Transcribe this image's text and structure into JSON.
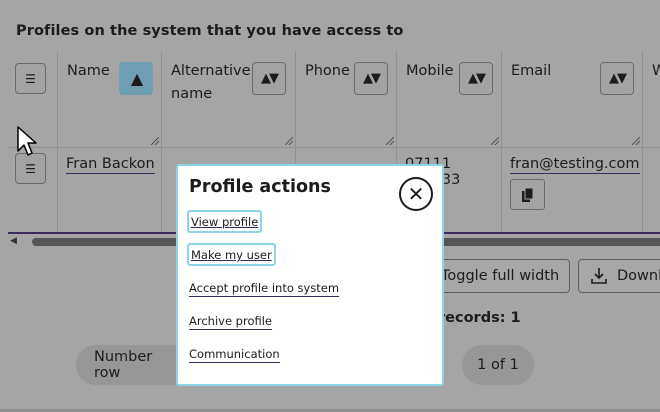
{
  "page": {
    "heading": "Profiles on the system that you have access to"
  },
  "table": {
    "row_menu_icon": "☰",
    "columns": [
      {
        "label": "Name",
        "sort": "▲",
        "active": true
      },
      {
        "label": "Alternative name",
        "sort": "▲▼"
      },
      {
        "label": "Phone",
        "sort": "▲▼"
      },
      {
        "label": "Mobile",
        "sort": "▲▼"
      },
      {
        "label": "Email",
        "sort": "▲▼"
      },
      {
        "label": "W"
      }
    ],
    "rows": [
      {
        "name": "Fran Backon",
        "alternative_name": "",
        "phone": "",
        "mobile": "07111 112233",
        "email": "fran@testing.com"
      }
    ]
  },
  "toolbar": {
    "toggle_full_width": "Toggle full width",
    "download": "Downl"
  },
  "summary": {
    "records": "records: 1"
  },
  "pagination": {
    "number_rows": "Number row",
    "page_info": "1 of 1"
  },
  "modal": {
    "title": "Profile actions",
    "close_icon": "close-icon",
    "close_glyph": "✕",
    "actions": [
      "View profile",
      "Make my user",
      "Accept profile into system",
      "Archive profile",
      "Communication"
    ]
  },
  "colors": {
    "overlay_background": "#a5a5a5",
    "active_sort": "#6e9eb2",
    "focus_ring": "#8fd3e6",
    "link_underline": "#3b2a5e"
  }
}
